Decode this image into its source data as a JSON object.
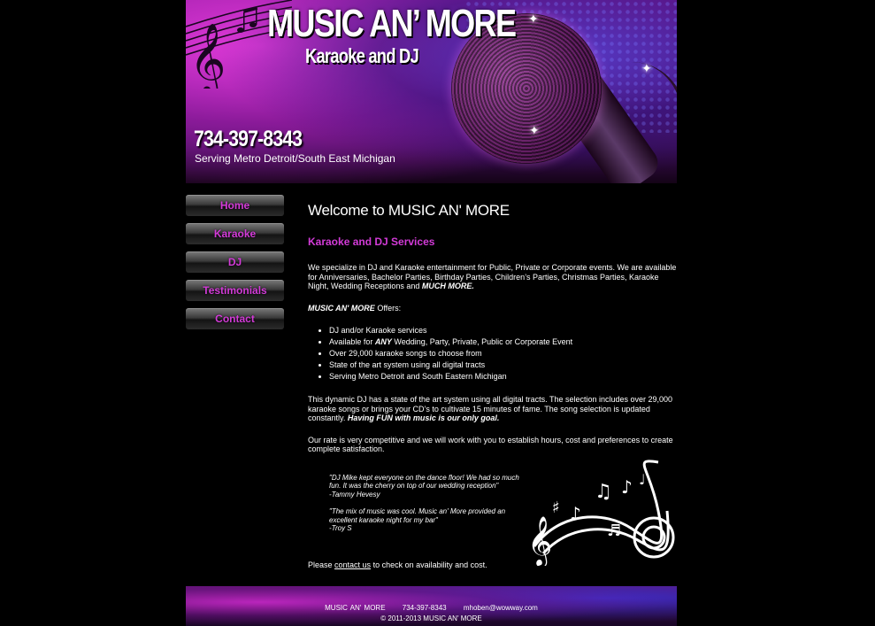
{
  "header": {
    "title": "MUSIC AN’ MORE",
    "subtitle": "Karaoke and DJ",
    "phone": "734-397-8343",
    "tagline": "Serving Metro Detroit/South East Michigan"
  },
  "nav": {
    "items": [
      {
        "label": "Home"
      },
      {
        "label": "Karaoke"
      },
      {
        "label": "DJ"
      },
      {
        "label": "Testimonials"
      },
      {
        "label": "Contact"
      }
    ]
  },
  "main": {
    "welcome": "Welcome to MUSIC AN' MORE",
    "services_heading": "Karaoke and DJ Services",
    "intro_text": "We specialize in DJ and Karaoke entertainment for Public, Private or Corporate events. We are available for Anniversaries, Bachelor Parties, Birthday Parties, Children’s Parties, Christmas Parties, Karaoke Night, Wedding Receptions and ",
    "intro_emph": "MUCH MORE.",
    "offers_brand": "MUSIC AN' MORE",
    "offers_suffix": " Offers:",
    "offers": [
      {
        "text": "DJ and/or Karaoke services"
      },
      {
        "pre": "Available for ",
        "emph": "ANY",
        "post": " Wedding, Party, Private, Public or Corporate Event"
      },
      {
        "text": "Over 29,000 karaoke songs to choose from"
      },
      {
        "text": "State of the art system using all digital tracts"
      },
      {
        "text": "Serving Metro Detroit and South Eastern Michigan"
      }
    ],
    "dj_text": "This dynamic DJ has a state of the art system using all digital tracts. The selection includes over 29,000 karaoke songs or brings your CD’s to cultivate 15 minutes of fame. The song selection is updated constantly. ",
    "dj_emph": "Having FUN with music is our only goal.",
    "rate_text": "Our rate is very competitive and we will work with you to establish hours, cost and preferences to create complete satisfaction.",
    "testimonials": [
      {
        "quote": "\"DJ Mike kept everyone on the dance floor! We had so much fun. It was the cherry on top of our wedding reception\"",
        "author": "-Tammy Hevesy"
      },
      {
        "quote": "\"The mix of music was cool. Music an' More provided an excellent karaoke night for my bar\"",
        "author": "-Troy S"
      }
    ],
    "contact_pre": "Please ",
    "contact_link": "contact us",
    "contact_post": " to check on availability and cost."
  },
  "footer": {
    "name": "MUSIC AN' MORE",
    "phone": "734-397-8343",
    "email": "mhoben@wowway.com",
    "copyright": "© 2011-2013 MUSIC AN' MORE"
  },
  "colors": {
    "accent": "#d33bd8",
    "background": "#000000"
  }
}
